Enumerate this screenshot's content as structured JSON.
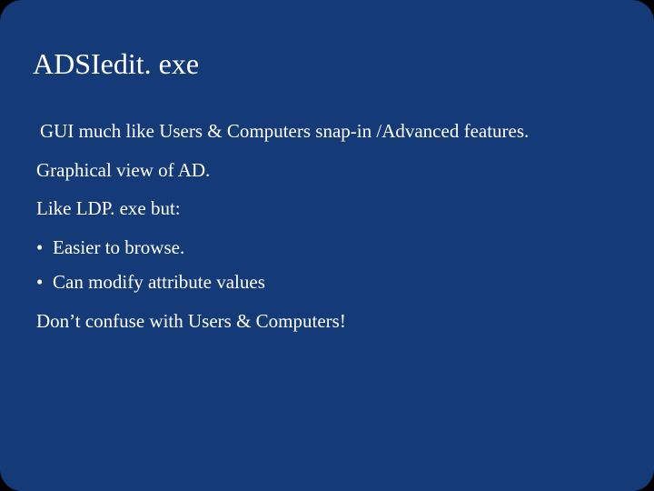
{
  "slide": {
    "title": "ADSIedit. exe",
    "line1": "GUI much like Users & Computers snap-in /Advanced features.",
    "line2": "Graphical view of AD.",
    "line3": "Like LDP. exe but:",
    "bullets": {
      "b1": "Easier to browse.",
      "b2": "Can modify attribute values"
    },
    "line4": "Don’t confuse with Users & Computers!"
  }
}
